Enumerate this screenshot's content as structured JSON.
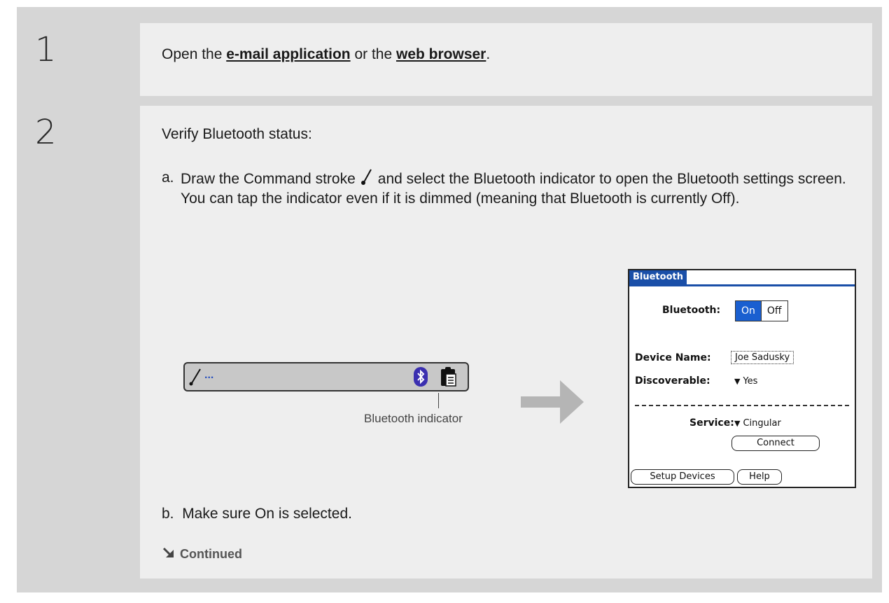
{
  "steps": [
    {
      "number": "1",
      "text_before": "Open the ",
      "link1": "e-mail application",
      "text_mid": " or the ",
      "link2": "web browser",
      "text_after": "."
    },
    {
      "number": "2",
      "intro": "Verify Bluetooth status:",
      "a_marker": "a.",
      "a_text_before": "Draw the Command stroke",
      "a_text_after": "and select the Bluetooth indicator to open the Bluetooth settings screen. You can tap the indicator even if it is dimmed (meaning that Bluetooth is currently Off).",
      "b_marker": "b.",
      "b_text": "Make sure On is selected.",
      "continued": "Continued"
    }
  ],
  "status_bar": {
    "dots": "...",
    "callout": "Bluetooth indicator"
  },
  "palm_screen": {
    "title": "Bluetooth",
    "bluetooth_label": "Bluetooth:",
    "on": "On",
    "off": "Off",
    "device_name_label": "Device Name:",
    "device_name_value": "Joe Sadusky",
    "discoverable_label": "Discoverable:",
    "discoverable_value": "Yes",
    "service_label": "Service:",
    "service_value": "Cingular",
    "connect_button": "Connect",
    "setup_button": "Setup Devices",
    "help_button": "Help"
  },
  "colors": {
    "frame": "#d6d6d6",
    "content": "#eeeeee",
    "palm_accent": "#1a4fa8",
    "bluetooth_icon": "#3b2fb0",
    "arrow": "#b5b5b5"
  }
}
